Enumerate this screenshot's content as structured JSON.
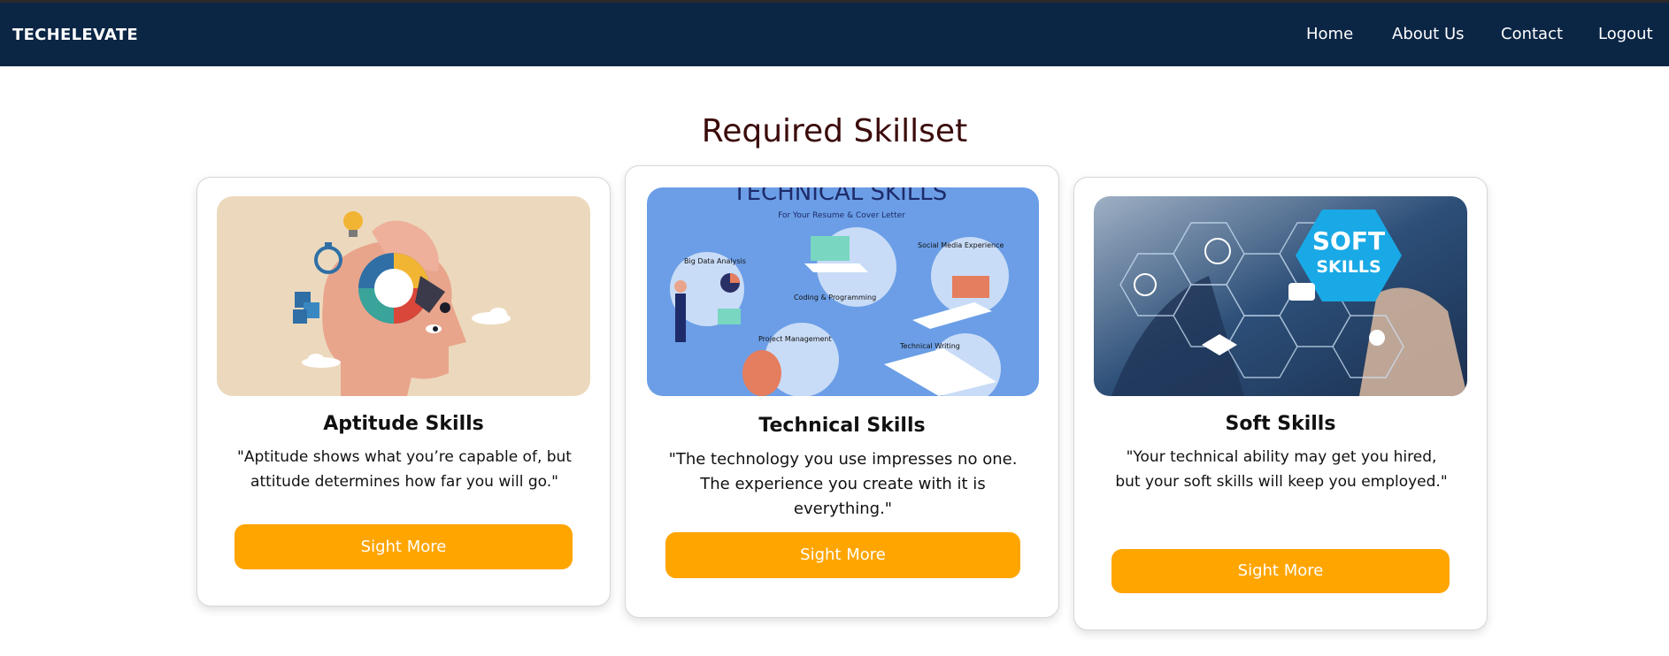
{
  "nav": {
    "brand": "TECHELEVATE",
    "links": [
      "Home",
      "About Us",
      "Contact",
      "Logout"
    ]
  },
  "section": {
    "title": "Required Skillset"
  },
  "cards": [
    {
      "title": "Aptitude Skills",
      "quote": "\"Aptitude shows what you’re capable of, but attitude determines how far you will go.\"",
      "button": "Sight More",
      "image_icon": "aptitude-head-illustration"
    },
    {
      "title": "Technical Skills",
      "quote": "\"The technology you use impresses no one. The experience you create with it is everything.\"",
      "button": "Sight More",
      "image_icon": "technical-skills-illustration",
      "image_text": {
        "heading": "TECHNICAL SKILLS",
        "subheading": "For Your Resume & Cover Letter",
        "labels": [
          "Big Data Analysis",
          "Coding & Programming",
          "Social Media Experience",
          "Project Management",
          "Technical Writing"
        ]
      }
    },
    {
      "title": "Soft Skills",
      "quote": "\"Your technical ability may get you hired, but your soft skills will keep you employed.\"",
      "button": "Sight More",
      "image_icon": "soft-skills-hexagon-illustration",
      "image_text": {
        "badge_line1": "SOFT",
        "badge_line2": "SKILLS"
      }
    }
  ],
  "colors": {
    "navbar": "#0b2545",
    "title": "#3b0a0a",
    "button": "#ffa500",
    "card_border": "#d6d6d6"
  }
}
